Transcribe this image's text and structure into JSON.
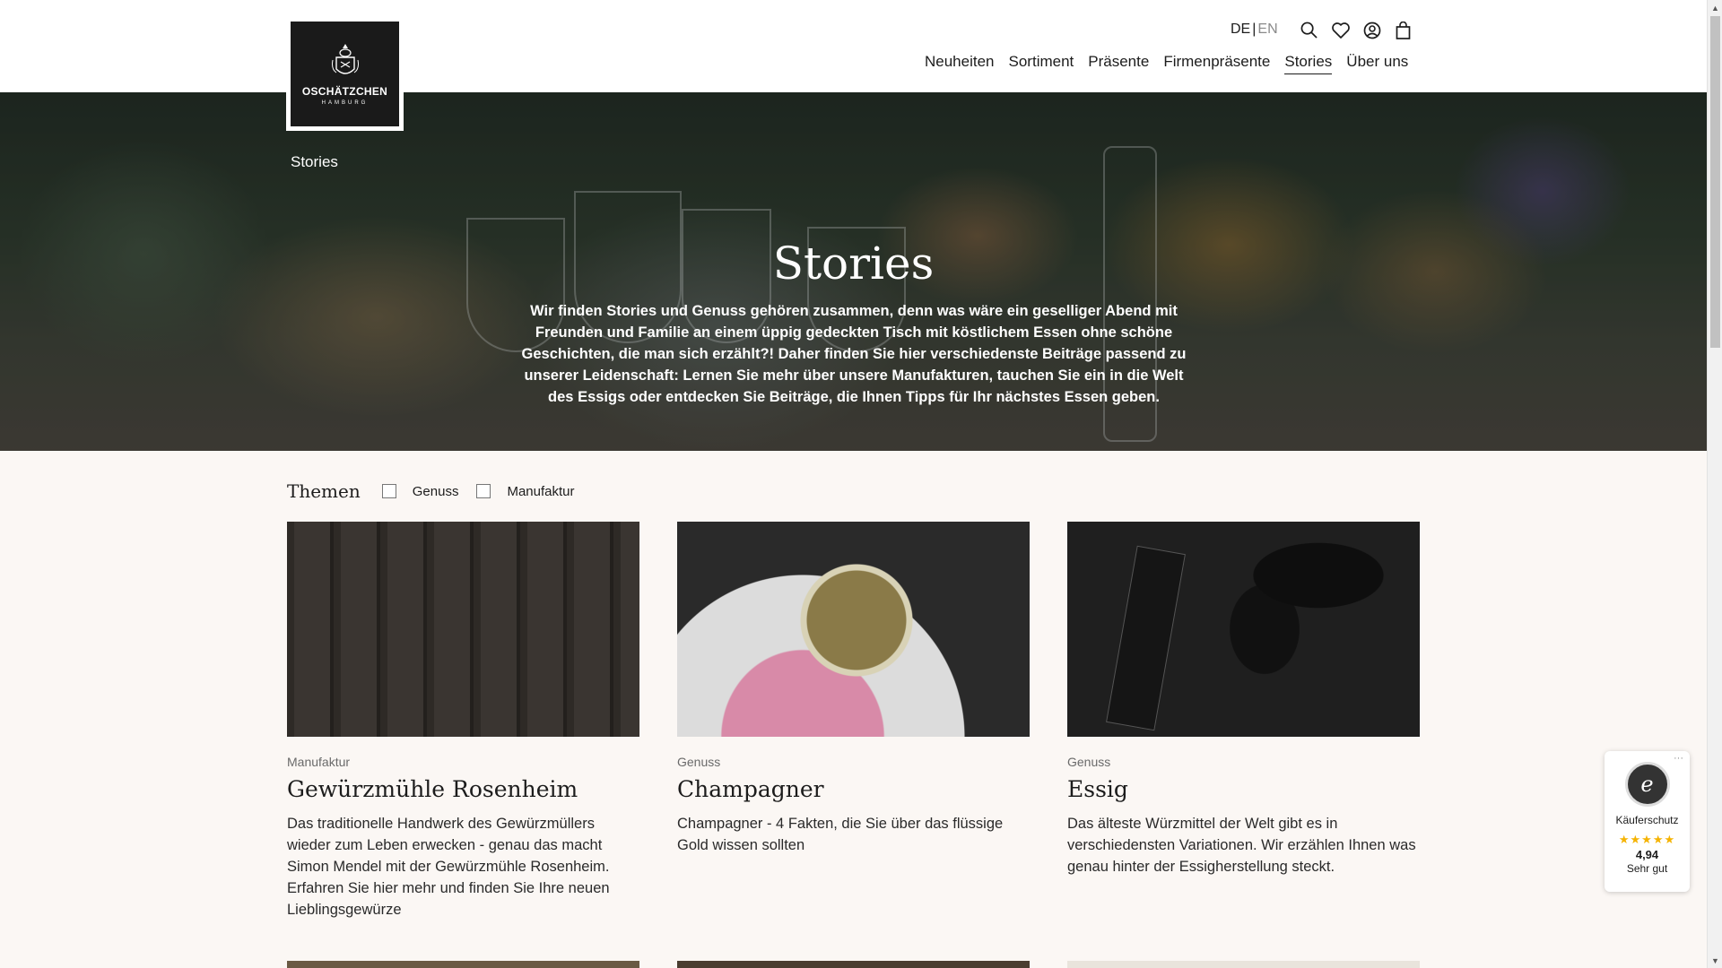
{
  "header": {
    "logo": {
      "name": "OSCHÄTZCHEN",
      "sub": "HAMBURG"
    },
    "lang": {
      "de": "DE",
      "sep": "|",
      "en": "EN"
    },
    "nav": [
      "Neuheiten",
      "Sortiment",
      "Präsente",
      "Firmenpräsente",
      "Stories",
      "Über uns"
    ],
    "active_nav": "Stories"
  },
  "hero": {
    "breadcrumb": "Stories",
    "title": "Stories",
    "text": "Wir finden Stories und Genuss gehören zusammen, denn was wäre ein geselliger Abend mit Freunden und Familie an einem üppig gedeckten Tisch mit köstlichem Essen ohne schöne Geschichten, die man sich erzählt?! Daher finden Sie hier verschiedenste Beiträge passend zu unserer Leidenschaft: Lernen Sie mehr über unsere Manufakturen, tauchen Sie ein in die Welt des Essigs oder entdecken Sie Beiträge, die Ihnen Tipps für Ihr nächstes Essen geben."
  },
  "filters": {
    "label": "Themen",
    "options": [
      "Genuss",
      "Manufaktur"
    ]
  },
  "cards": [
    {
      "category": "Manufaktur",
      "title": "Gewürzmühle Rosenheim",
      "description": "Das traditionelle Handwerk des Gewürzmüllers wieder zum Leben erwecken - genau das macht Simon Mendel mit der Gewürzmühle Rosenheim. Erfahren Sie hier mehr und finden Sie Ihre neuen Lieblingsgewürze"
    },
    {
      "category": "Genuss",
      "title": "Champagner",
      "description": "Champagner - 4 Fakten, die Sie über das flüssige Gold wissen sollten"
    },
    {
      "category": "Genuss",
      "title": "Essig",
      "description": "Das älteste Würzmittel der Welt gibt es in verschiedensten Variationen. Wir erzählen Ihnen was genau hinter der Essigherstellung steckt."
    }
  ],
  "trust_badge": {
    "seal": "e",
    "label": "Käuferschutz",
    "stars": "★★★★★",
    "score": "4,94",
    "rating": "Sehr gut",
    "more": "···"
  },
  "icons": [
    "search-icon",
    "heart-icon",
    "account-icon",
    "bag-icon"
  ],
  "colors": {
    "star": "#f5b301",
    "logo_bg": "#1a1a1a",
    "page_bg": "#fbf7f4"
  }
}
